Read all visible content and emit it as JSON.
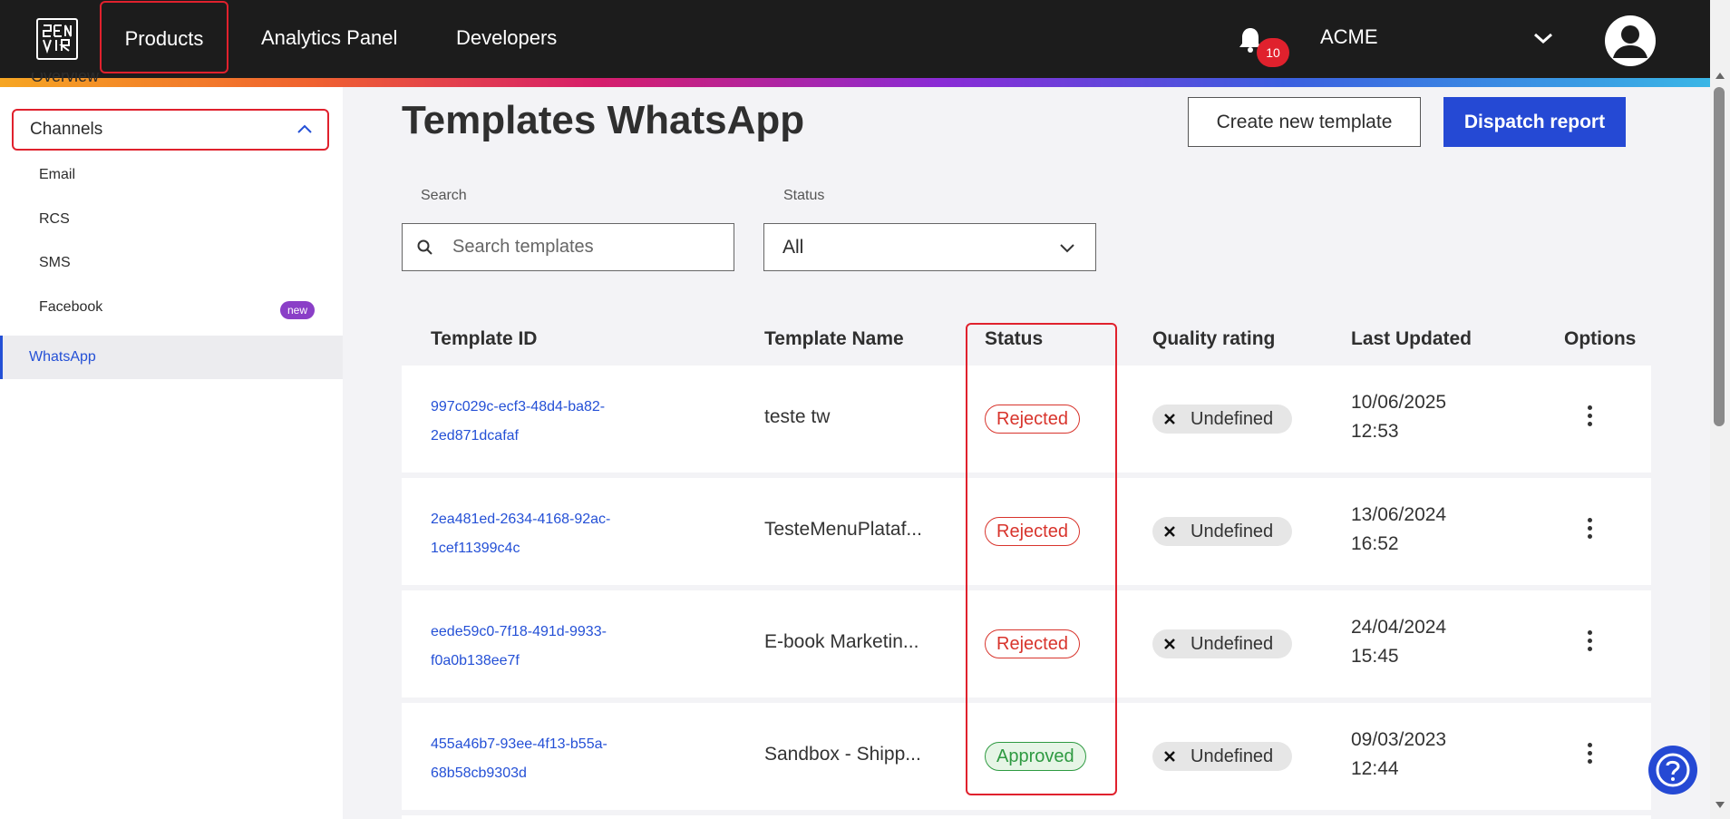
{
  "topbar": {
    "nav": [
      "Products",
      "Analytics Panel",
      "Developers"
    ],
    "notifications_count": "10",
    "org_name": "ACME"
  },
  "sidebar": {
    "overview_label": "Overview",
    "channels_label": "Channels",
    "items": [
      {
        "label": "Email"
      },
      {
        "label": "RCS"
      },
      {
        "label": "SMS"
      },
      {
        "label": "Facebook",
        "badge": "new"
      }
    ],
    "active_item": "WhatsApp"
  },
  "main": {
    "title": "Templates WhatsApp",
    "create_button": "Create new template",
    "dispatch_button": "Dispatch report",
    "search_label": "Search",
    "search_placeholder": "Search templates",
    "status_label": "Status",
    "status_value": "All"
  },
  "table": {
    "columns": [
      "Template ID",
      "Template Name",
      "Status",
      "Quality rating",
      "Last Updated",
      "Options"
    ],
    "rows": [
      {
        "id_line1": "997c029c-ecf3-48d4-ba82-",
        "id_line2": "2ed871dcafaf",
        "name": "teste tw",
        "status": "Rejected",
        "quality": "Undefined",
        "date": "10/06/2025",
        "time": "12:53"
      },
      {
        "id_line1": "2ea481ed-2634-4168-92ac-",
        "id_line2": "1cef11399c4c",
        "name": "TesteMenuPlataf...",
        "status": "Rejected",
        "quality": "Undefined",
        "date": "13/06/2024",
        "time": "16:52"
      },
      {
        "id_line1": "eede59c0-7f18-491d-9933-",
        "id_line2": "f0a0b138ee7f",
        "name": "E-book Marketin...",
        "status": "Rejected",
        "quality": "Undefined",
        "date": "24/04/2024",
        "time": "15:45"
      },
      {
        "id_line1": "455a46b7-93ee-4f13-b55a-",
        "id_line2": "68b58cb9303d",
        "name": "Sandbox - Shipp...",
        "status": "Approved",
        "quality": "Undefined",
        "date": "09/03/2023",
        "time": "12:44"
      }
    ]
  },
  "colors": {
    "accent_blue": "#2549d4",
    "highlight_red": "#e0212d",
    "rejected": "#d8342c",
    "approved": "#2e9a41"
  }
}
